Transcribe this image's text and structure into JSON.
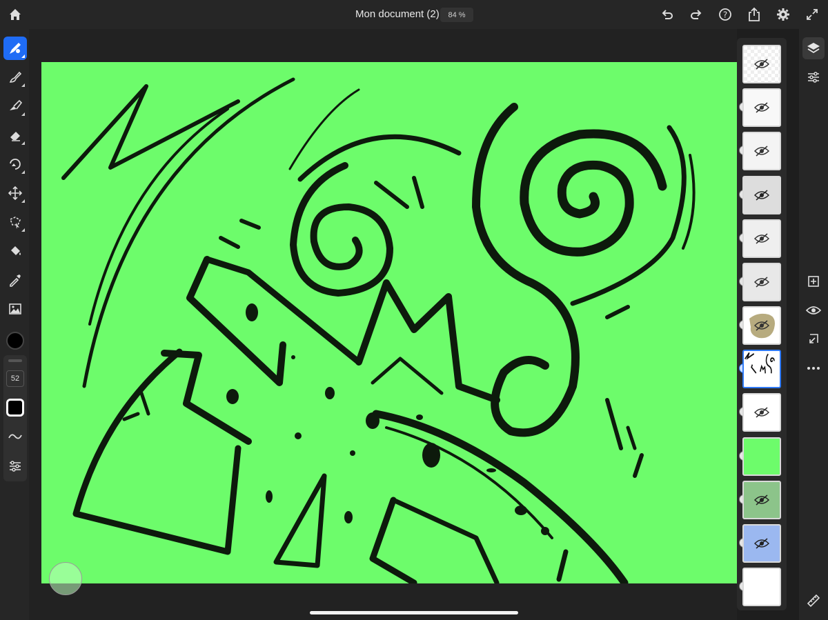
{
  "header": {
    "document_title": "Mon document (2)",
    "zoom_level": "84 %"
  },
  "toolbar": {
    "brush_size": "52",
    "current_color": "#000000"
  },
  "canvas": {
    "background_color": "#6dfc6b"
  },
  "layers": {
    "count": 13,
    "selected_index": 7
  },
  "colors": {
    "accent": "#1f6cf5",
    "chrome": "#262626"
  }
}
